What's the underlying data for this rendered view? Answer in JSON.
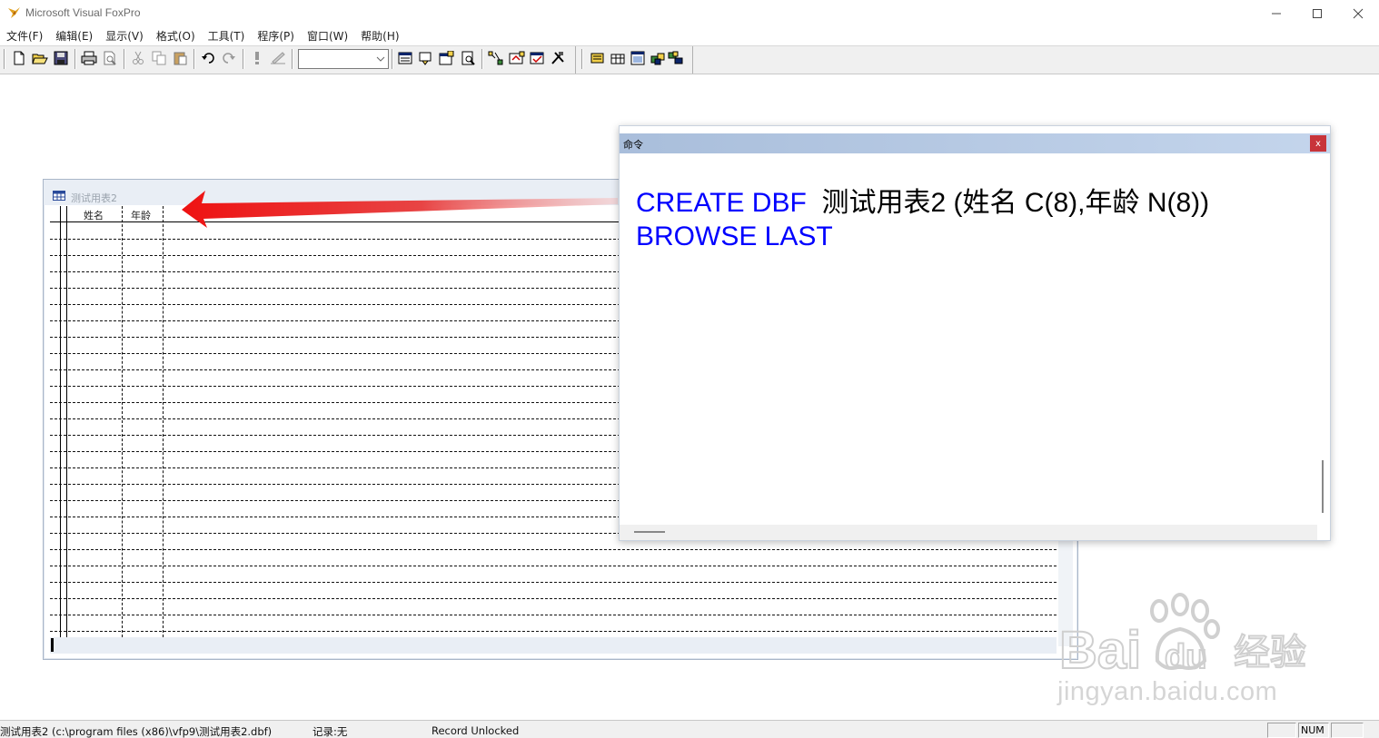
{
  "window": {
    "title": "Microsoft Visual FoxPro",
    "logo_icon": "foxpro-logo-icon"
  },
  "menu": [
    {
      "label": "文件(F)"
    },
    {
      "label": "编辑(E)"
    },
    {
      "label": "显示(V)"
    },
    {
      "label": "格式(O)"
    },
    {
      "label": "工具(T)"
    },
    {
      "label": "程序(P)"
    },
    {
      "label": "窗口(W)"
    },
    {
      "label": "帮助(H)"
    }
  ],
  "toolbar": {
    "buttons": [
      "new-file-icon",
      "open-folder-icon",
      "save-icon",
      "print-icon",
      "print-preview-icon",
      "cut-icon",
      "copy-icon",
      "paste-icon",
      "undo-icon",
      "redo-icon",
      "run-icon",
      "modify-form-icon",
      "data-session-icon",
      "properties-icon",
      "code-window-icon",
      "form-designer-icon",
      "connections-icon",
      "build-icon",
      "report-icon",
      "command-window-icon",
      "view-window-icon",
      "data-environment-icon",
      "project-manager-icon",
      "toolbox-icon"
    ],
    "combo_value": ""
  },
  "browse": {
    "title": "测试用表2",
    "columns": [
      {
        "label": "姓名"
      },
      {
        "label": "年龄"
      }
    ]
  },
  "command": {
    "title": "命令",
    "close_label": "x",
    "line1_kw": "CREATE DBF",
    "line1_rest": "测试用表2 (姓名 C(8),年龄 N(8))",
    "line2_kw": "BROWSE LAST"
  },
  "watermark": {
    "brand": "Bai",
    "brand2": "du",
    "cn": "经验",
    "site": "jingyan.baidu.com"
  },
  "status": {
    "file": "测试用表2 (c:\\program files (x86)\\vfp9\\测试用表2.dbf)",
    "records": "记录:无",
    "lock": "Record Unlocked",
    "num": "NUM"
  },
  "colors": {
    "keyword": "#0000ff",
    "command_title_bar": "#b3c7e3",
    "arrow": "#e81818"
  }
}
